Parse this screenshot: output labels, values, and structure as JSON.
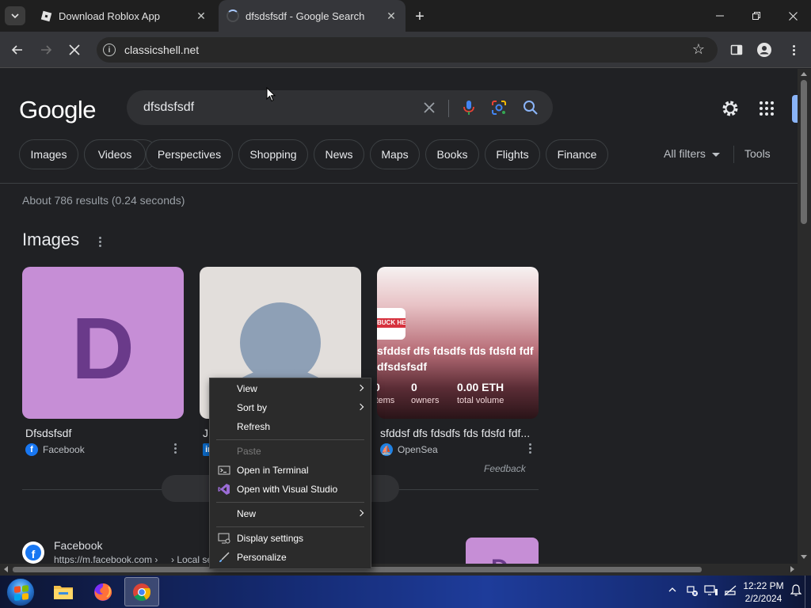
{
  "window": {
    "tabs": [
      {
        "title": "Download Roblox App",
        "active": false
      },
      {
        "title": "dfsdsfsdf - Google Search",
        "active": true
      }
    ],
    "close_glyph": "✕",
    "new_tab_glyph": "+",
    "minimize_glyph": "—",
    "maximize_glyph": "❐",
    "window_close_glyph": "✕"
  },
  "toolbar": {
    "back_glyph": "←",
    "forward_glyph": "→",
    "stop_glyph": "✕",
    "url": "classicshell.net",
    "star_glyph": "☆"
  },
  "search": {
    "logo": "Google",
    "query": "dfsdsfsdf",
    "clear_glyph": "✕",
    "chips": [
      "Images",
      "Videos",
      "Perspectives",
      "Shopping",
      "News",
      "Maps",
      "Books",
      "Flights",
      "Finance"
    ],
    "all_filters": "All filters",
    "tools": "Tools",
    "result_stats": "About 786 results (0.24 seconds)"
  },
  "images_section": {
    "heading": "Images",
    "items": [
      {
        "thumb_letter": "D",
        "caption": "Dfsdsfsdf",
        "source": "Facebook"
      },
      {
        "caption": "J",
        "source": ""
      },
      {
        "caption": "sfddsf dfs fdsdfs fds fdsfd fdf...",
        "source": "OpenSea",
        "thumb_text_1": "sfddsf dfs fdsdfs fds fdsfd fdf",
        "thumb_text_2": "dfsdsfsdf",
        "banner_text": "BUCK HER",
        "stats": [
          {
            "value": "0",
            "label": "items"
          },
          {
            "value": "0",
            "label": "owners"
          },
          {
            "value": "0.00 ETH",
            "label": "total volume"
          }
        ]
      }
    ],
    "feedback": "Feedback"
  },
  "result": {
    "title": "Facebook",
    "url": "https://m.facebook.com ›",
    "url_tail": "› Local se",
    "thumb_letter": "D"
  },
  "context_menu": {
    "items": [
      {
        "label": "View",
        "submenu": true
      },
      {
        "label": "Sort by",
        "submenu": true
      },
      {
        "label": "Refresh"
      },
      {
        "label": "Paste",
        "disabled": true
      },
      {
        "label": "Open in Terminal"
      },
      {
        "label": "Open with Visual Studio"
      },
      {
        "label": "New",
        "submenu": true
      },
      {
        "label": "Display settings"
      },
      {
        "label": "Personalize"
      }
    ]
  },
  "taskbar": {
    "time": "12:22 PM",
    "date": "2/2/2024",
    "tray_up_glyph": "^"
  },
  "colors": {
    "page_bg": "#202124",
    "accent_blue": "#8ab4f8",
    "chip_border": "#3c4043"
  }
}
